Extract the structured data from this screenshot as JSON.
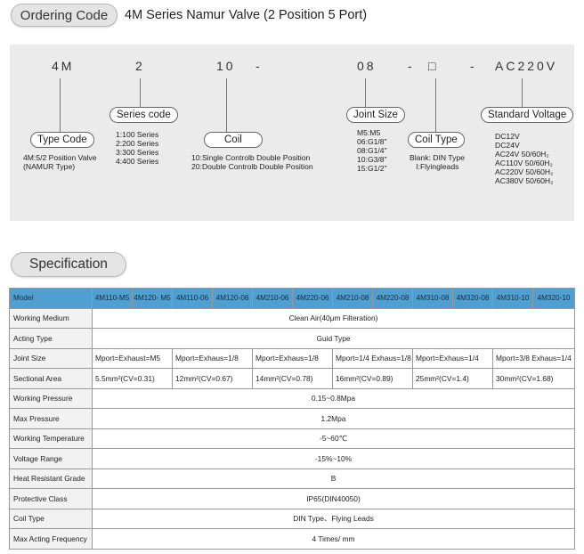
{
  "ordering": {
    "heading": "Ordering Code",
    "title": "4M Series Namur Valve (2 Position 5 Port)",
    "code": {
      "p1": "4M",
      "p2": "2",
      "p3": "10",
      "d1": "-",
      "p4": "08",
      "d2": "-",
      "p5": "□",
      "d3": "-",
      "p6": "AC220V"
    },
    "type_code": {
      "label": "Type Code",
      "desc": "4M:5/2 Position Valve\n(NAMUR Type)"
    },
    "series_code": {
      "label": "Series code",
      "desc": "1:100 Series\n2:200 Series\n3:300 Series\n4:400 Series"
    },
    "coil": {
      "label": "Coil",
      "desc": "10:Single Controlb Double Position\n20:Double Controlb Double Position"
    },
    "joint_size": {
      "label": "Joint Size",
      "desc": "M5:M5\n06:G1/8\"\n08:G1/4\"\n10:G3/8\"\n15:G1/2\""
    },
    "coil_type": {
      "label": "Coil Type",
      "desc": "Blank: DIN Type\n   I:Flyingleads"
    },
    "standard_voltage": {
      "label": "Standard Voltage",
      "desc": "DC12V\nDC24V\nAC24V 50/60H₂\nAC110V 50/60H₂\nAC220V 50/60H₂\nAC380V 50/60H₂"
    }
  },
  "spec": {
    "heading": "Specification",
    "header": [
      "Model",
      "4M110-M5",
      "4M120- M5",
      "4M110-06",
      "4M120-06",
      "4M210-06",
      "4M220-06",
      "4M210-08",
      "4M220-08",
      "4M310-08",
      "4M320-08",
      "4M310-10",
      "4M320-10"
    ],
    "working_medium": {
      "label": "Working Medium",
      "value": "Clean Air(40μm Filteration)"
    },
    "acting_type": {
      "label": "Acting Type",
      "value": "Guid Type"
    },
    "joint_size": {
      "label": "Joint Size",
      "values": [
        "Mport=Exhaust=M5",
        "Mport=Exhaus=1/8",
        "Mport=Exhaus=1/8",
        "Mport=1/4  Exhaus=1/8",
        "Mport=Exhaus=1/4",
        "Mport=3/8  Exhaus=1/4"
      ]
    },
    "sectional_area": {
      "label": "Sectional Area",
      "values": [
        "5.5mm²(CV=0.31)",
        "12mm²(CV=0.67)",
        "14mm²(CV=0.78)",
        "16mm²(CV=0.89)",
        "25mm²(CV=1.4)",
        "30mm²(CV=1.68)"
      ]
    },
    "working_pressure": {
      "label": "Working Pressure",
      "value": "0.15~0.8Mpa"
    },
    "max_pressure": {
      "label": "Max Pressure",
      "value": "1.2Mpa"
    },
    "working_temperature": {
      "label": "Working Temperature",
      "value": "-5~60℃"
    },
    "voltage_range": {
      "label": "Voltage Range",
      "value": "-15%~10%"
    },
    "heat_resistant_grade": {
      "label": "Heat Resistant Grade",
      "value": "B"
    },
    "protective_class": {
      "label": "Protective Class",
      "value": "IP65(DIN40050)"
    },
    "coil_type": {
      "label": "Coil Type",
      "value": "DIN Type、Flying Leads"
    },
    "max_acting_frequency": {
      "label": "Max Acting Frequency",
      "value": "4 Times/ mm"
    }
  }
}
